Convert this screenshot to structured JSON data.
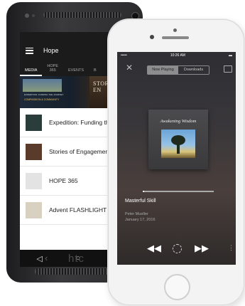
{
  "android": {
    "brand": "htc",
    "app_title": "Hope",
    "tabs": [
      "MEDIA",
      "HOPE\n365",
      "EVENTS",
      "B"
    ],
    "banner": {
      "left_caption": "EXPEDITION: FUNDING THE JOURNEY",
      "left_subcaption": "COMPASSION & COMMUNITY",
      "right_title": "STORIES of EN"
    },
    "items": [
      {
        "label": "Expedition: Funding the J",
        "thumb_color": "#2a3d3a"
      },
      {
        "label": "Stories of Engagement",
        "thumb_color": "#5a3a2a"
      },
      {
        "label": "HOPE 365",
        "thumb_color": "#e3e3e3"
      },
      {
        "label": "Advent FLASHLIGHT",
        "thumb_color": "#d8d0c0"
      }
    ],
    "nav": {
      "back": "◁",
      "home": "○",
      "recent": "□"
    }
  },
  "iphone": {
    "status": {
      "carrier": "•••••",
      "time": "10:26 AM"
    },
    "close_icon": "✕",
    "segments": {
      "now_playing": "Now Playing",
      "downloads": "Downloads"
    },
    "album_title": "Awakening Wisdom",
    "song_title": "Masterful Skill",
    "artist": "Peter Mueller",
    "date": "January 17, 2016",
    "controls": {
      "rewind": "◀◀",
      "forward": "▶▶",
      "more": "⋮"
    }
  }
}
